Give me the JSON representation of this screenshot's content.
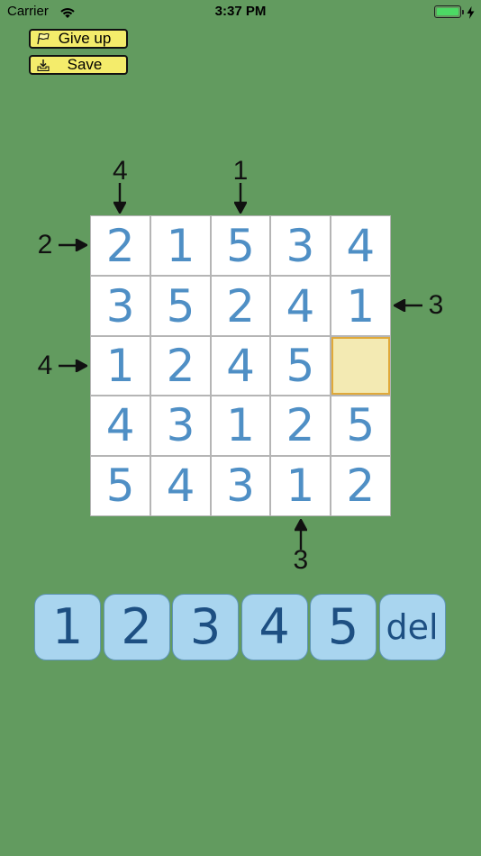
{
  "status_bar": {
    "carrier": "Carrier",
    "time": "3:37 PM",
    "wifi_icon": "wifi-icon",
    "battery_icon": "battery-icon",
    "charging_icon": "bolt-icon",
    "battery_level": 1.0
  },
  "toolbar": {
    "give_up_label": "Give up",
    "give_up_icon": "flag-icon",
    "save_label": "Save",
    "save_icon": "download-tray-icon",
    "button_color": "#f4ec6b"
  },
  "puzzle": {
    "size": 5,
    "grid": [
      [
        "2",
        "1",
        "5",
        "3",
        "4"
      ],
      [
        "3",
        "5",
        "2",
        "4",
        "1"
      ],
      [
        "1",
        "2",
        "4",
        "5",
        ""
      ],
      [
        "4",
        "3",
        "1",
        "2",
        "5"
      ],
      [
        "5",
        "4",
        "3",
        "1",
        "2"
      ]
    ],
    "selected_cell": {
      "row": 2,
      "col": 4
    },
    "clues": {
      "top": [
        {
          "col": 0,
          "value": "4"
        },
        {
          "col": 2,
          "value": "1"
        }
      ],
      "left": [
        {
          "row": 0,
          "value": "2"
        },
        {
          "row": 2,
          "value": "4"
        }
      ],
      "right": [
        {
          "row": 1,
          "value": "3"
        }
      ],
      "bottom": [
        {
          "col": 3,
          "value": "3"
        }
      ]
    },
    "digit_color": "#4f8fc5",
    "selected_color": "#f3eab3"
  },
  "keypad": {
    "keys": [
      "1",
      "2",
      "3",
      "4",
      "5",
      "del"
    ],
    "key_color": "#a9d5ef",
    "text_color": "#1d4f82"
  },
  "background_color": "#629b5f"
}
